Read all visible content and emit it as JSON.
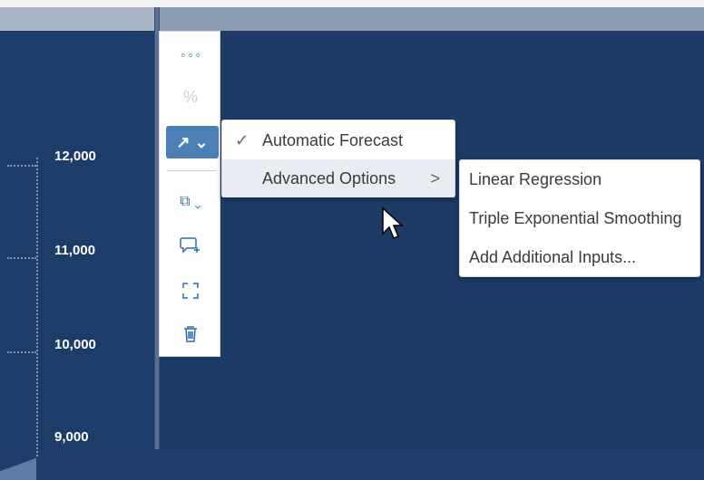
{
  "chart": {
    "ticks": [
      "12,000",
      "11,000",
      "10,000",
      "9,000"
    ]
  },
  "toolbar": {
    "items": [
      {
        "name": "more",
        "glyph": "∘∘∘"
      },
      {
        "name": "percent",
        "glyph": "%"
      },
      {
        "name": "forecast",
        "glyph": "↗ ⌄"
      },
      {
        "name": "copy",
        "glyph": "⧉ ⌄"
      },
      {
        "name": "comment",
        "glyph": "💬"
      },
      {
        "name": "fullscreen",
        "glyph": "⛶"
      },
      {
        "name": "delete",
        "glyph": "🗑"
      }
    ]
  },
  "menu": {
    "check": "✓",
    "automatic_forecast": "Automatic Forecast",
    "advanced_options": "Advanced Options",
    "chevron": ">"
  },
  "submenu": {
    "items": [
      "Linear Regression",
      "Triple Exponential Smoothing",
      "Add Additional Inputs..."
    ]
  }
}
